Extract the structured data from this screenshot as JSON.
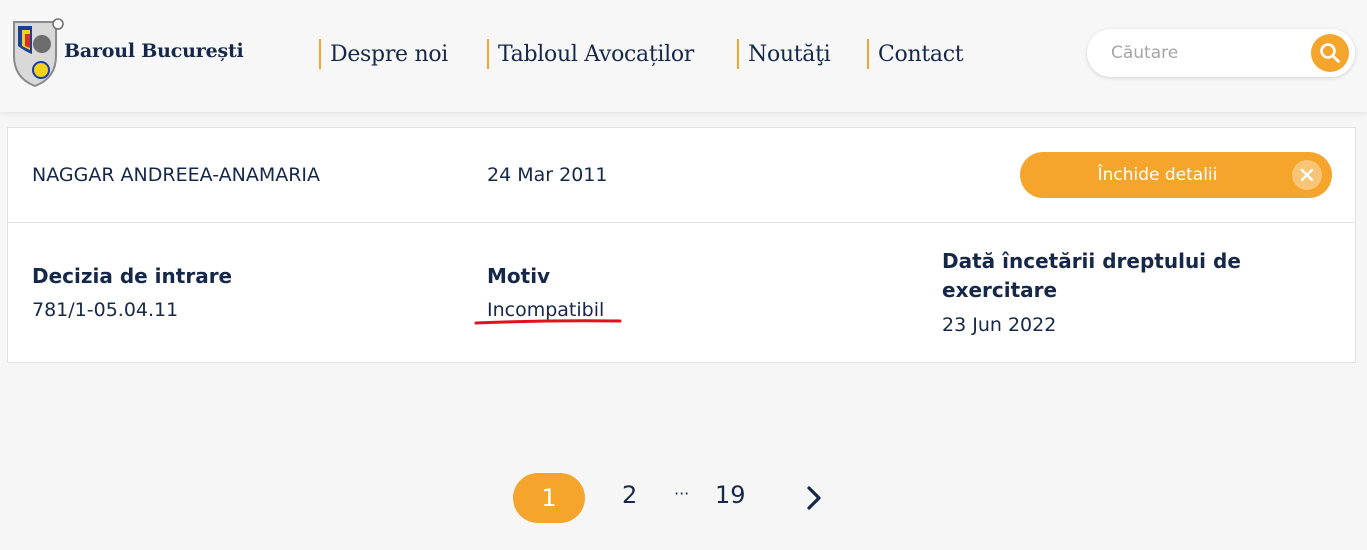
{
  "header": {
    "brand": "Baroul București",
    "nav": [
      "Despre noi",
      "Tabloul Avocaților",
      "Noutăţi",
      "Contact"
    ],
    "search": {
      "placeholder": "Căutare"
    },
    "colors": {
      "accent": "#f5a52c",
      "text": "#16284a"
    }
  },
  "record": {
    "name": "NAGGAR ANDREEA-ANAMARIA",
    "date": "24 Mar 2011",
    "close_label": "Închide detalii",
    "details": [
      {
        "label": "Decizia de intrare",
        "value": "781/1-05.04.11"
      },
      {
        "label": "Motiv",
        "value": "Incompatibil"
      },
      {
        "label": "Dată încetării dreptului de exercitare",
        "value": "23 Jun 2022"
      }
    ]
  },
  "pagination": {
    "current": "1",
    "pages": [
      "2",
      "19"
    ],
    "ellipsis": "···"
  },
  "icons": [
    "bar-crest-logo-icon",
    "search-icon",
    "close-icon",
    "chevron-right-icon"
  ]
}
